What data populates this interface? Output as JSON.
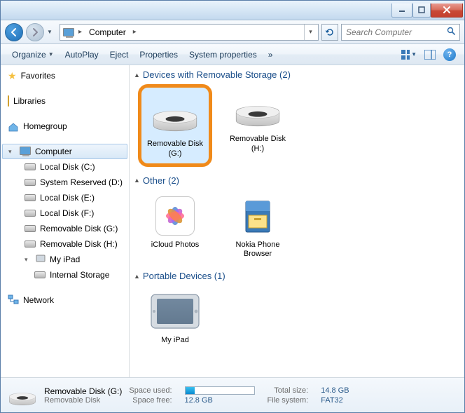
{
  "address": {
    "root": "Computer"
  },
  "search": {
    "placeholder": "Search Computer"
  },
  "toolbar": {
    "organize": "Organize",
    "autoplay": "AutoPlay",
    "eject": "Eject",
    "properties": "Properties",
    "system_properties": "System properties",
    "overflow": "»"
  },
  "sidebar": {
    "favorites": "Favorites",
    "libraries": "Libraries",
    "homegroup": "Homegroup",
    "computer": "Computer",
    "drives": [
      {
        "label": "Local Disk (C:)"
      },
      {
        "label": "System Reserved (D:)"
      },
      {
        "label": "Local Disk (E:)"
      },
      {
        "label": "Local Disk (F:)"
      },
      {
        "label": "Removable Disk (G:)"
      },
      {
        "label": "Removable Disk (H:)"
      },
      {
        "label": "My iPad"
      }
    ],
    "internal_storage": "Internal Storage",
    "network": "Network"
  },
  "sections": {
    "removable": {
      "title": "Devices with Removable Storage (2)"
    },
    "other": {
      "title": "Other (2)"
    },
    "portable": {
      "title": "Portable Devices (1)"
    }
  },
  "tiles": {
    "rem_g": "Removable Disk (G:)",
    "rem_h": "Removable Disk (H:)",
    "icloud": "iCloud Photos",
    "nokia": "Nokia Phone Browser",
    "ipad": "My iPad"
  },
  "status": {
    "name": "Removable Disk (G:)",
    "type": "Removable Disk",
    "space_used_label": "Space used:",
    "space_free_label": "Space free:",
    "space_free": "12.8 GB",
    "total_label": "Total size:",
    "total": "14.8 GB",
    "fs_label": "File system:",
    "fs": "FAT32"
  }
}
